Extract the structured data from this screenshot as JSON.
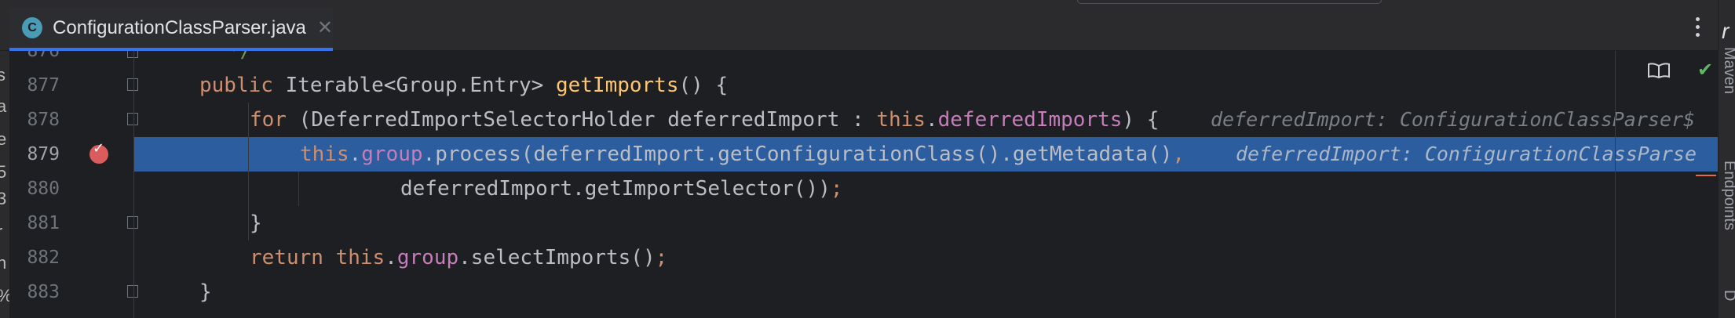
{
  "tab": {
    "icon_letter": "C",
    "title": "ConfigurationClassParser.java",
    "close_glyph": "✕"
  },
  "left_strip": [
    "s",
    "a",
    "e",
    "5",
    "3",
    "r",
    "n",
    "%"
  ],
  "right_strip": {
    "letter": "r",
    "labels": [
      "Maven",
      "Endpoints",
      "D"
    ]
  },
  "editor": {
    "lines": [
      {
        "number": "876",
        "text": "*/"
      },
      {
        "number": "877",
        "pre": "public ",
        "type": "Iterable<Group.Entry> ",
        "method": "getImports",
        "post": "() {"
      },
      {
        "number": "878",
        "kw": "for",
        "p1": " (DeferredImportSelectorHolder deferredImport : ",
        "this": "this",
        "dot": ".",
        "field": "deferredImports",
        "p2": ") {",
        "hint": "deferredImport: ConfigurationClassParser$"
      },
      {
        "number": "879",
        "this": "this",
        "dot": ".",
        "field": "group",
        "p1": ".process(deferredImport.getConfigurationClass().getMetadata()",
        "comma": ",",
        "hint": "deferredImport: ConfigurationClassParse"
      },
      {
        "number": "880",
        "text": "deferredImport.getImportSelector())",
        "semi": ";"
      },
      {
        "number": "881",
        "text": "}"
      },
      {
        "number": "882",
        "kw": "return",
        "sp": " ",
        "this": "this",
        "dot": ".",
        "field": "group",
        "p1": ".selectImports()",
        "semi": ";"
      },
      {
        "number": "883",
        "text": "}"
      }
    ]
  },
  "icons": {
    "breakpoint": "breakpoint-icon",
    "reader_mode": "book-icon",
    "inspections_ok": "checkmark-icon",
    "more": "kebab-icon",
    "ok_glyph": "✔",
    "bp_glyph": "✓"
  },
  "colors": {
    "editor_bg": "#1e1f22",
    "selection": "#2c5d9e",
    "keyword": "#cf8e6d",
    "field": "#c77dbb",
    "method": "#ffc66d",
    "breakpoint": "#db5c5c",
    "tab_underline": "#3574f0"
  }
}
